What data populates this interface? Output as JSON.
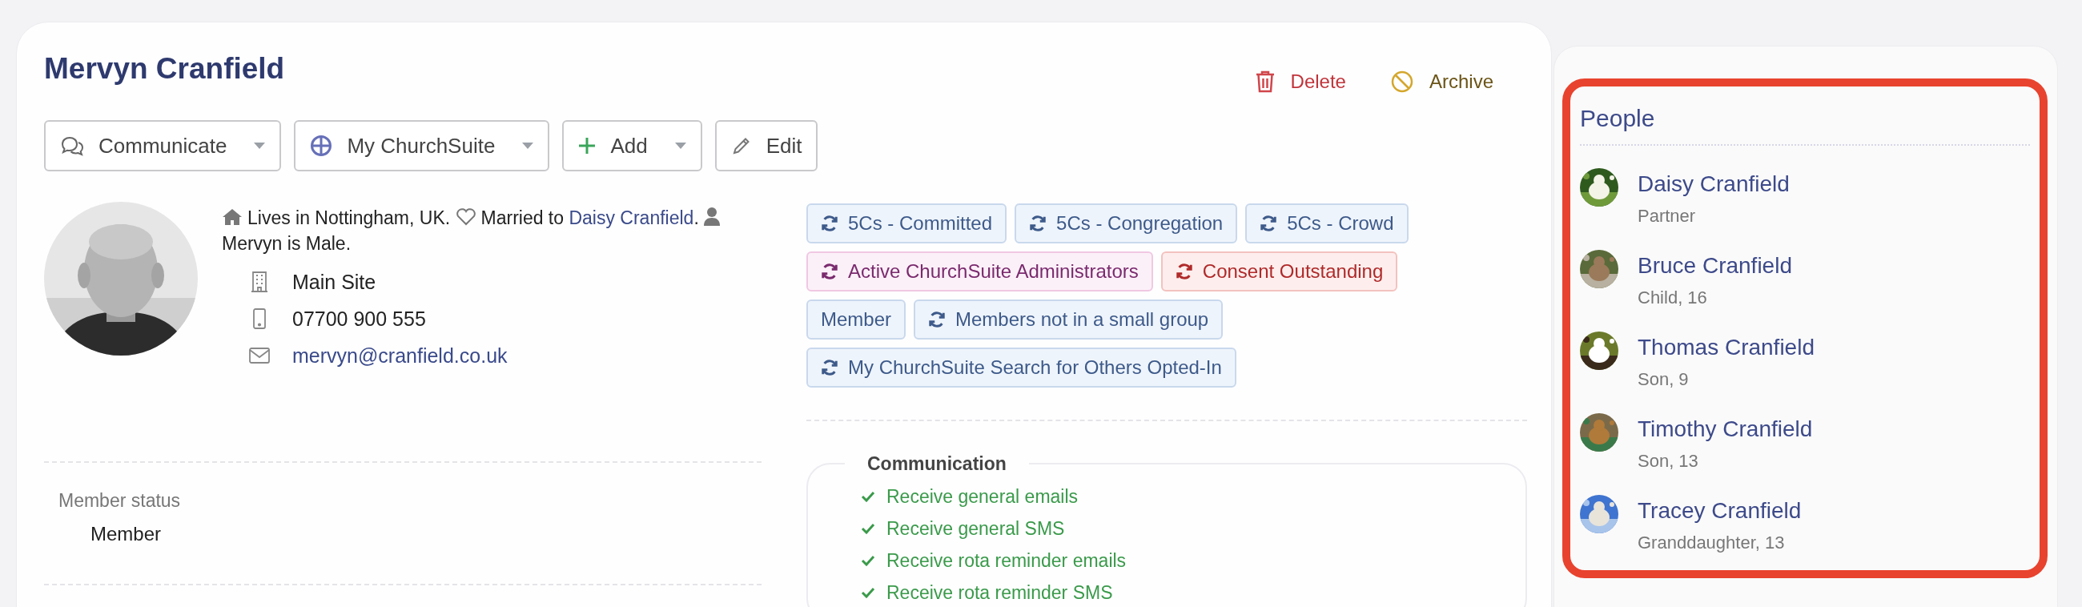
{
  "profile": {
    "name": "Mervyn Cranfield",
    "actions": [
      {
        "label": "Delete",
        "kind": "delete"
      },
      {
        "label": "Archive",
        "kind": "archive"
      }
    ],
    "buttons": [
      {
        "label": "Communicate",
        "kind": "chat",
        "dropdown": true
      },
      {
        "label": "My ChurchSuite",
        "kind": "globe",
        "dropdown": true
      },
      {
        "label": "Add",
        "kind": "plus",
        "dropdown": true
      },
      {
        "label": "Edit",
        "kind": "pencil",
        "dropdown": false
      }
    ],
    "summary": {
      "home": "Lives in Nottingham, UK.",
      "married_prefix": "Married to",
      "spouse": "Daisy Cranfield",
      "married_suffix": ".",
      "gender": "Mervyn is Male."
    },
    "contacts": [
      {
        "kind": "site",
        "text": "Main Site"
      },
      {
        "kind": "phone",
        "text": "07700 900 555"
      },
      {
        "kind": "email",
        "text": "mervyn@cranfield.co.uk"
      }
    ],
    "fields": [
      {
        "label": "Member status",
        "value": "Member"
      }
    ]
  },
  "tags": [
    {
      "label": "5Cs - Committed",
      "kind": "default",
      "synced": true
    },
    {
      "label": "5Cs - Congregation",
      "kind": "default",
      "synced": true
    },
    {
      "label": "5Cs - Crowd",
      "kind": "default",
      "synced": true
    },
    {
      "label": "Active ChurchSuite Administrators",
      "kind": "admin",
      "synced": true
    },
    {
      "label": "Consent Outstanding",
      "kind": "alert",
      "synced": true
    },
    {
      "label": "Member",
      "kind": "default",
      "synced": false
    },
    {
      "label": "Members not in a small group",
      "kind": "default",
      "synced": true
    },
    {
      "label": "My ChurchSuite Search for Others Opted-In",
      "kind": "default",
      "synced": true
    }
  ],
  "communication": {
    "title": "Communication",
    "items": [
      {
        "label": "Receive general emails",
        "checked": true
      },
      {
        "label": "Receive general SMS",
        "checked": true
      },
      {
        "label": "Receive rota reminder emails",
        "checked": true
      },
      {
        "label": "Receive rota reminder SMS",
        "checked": true
      }
    ]
  },
  "people": {
    "title": "People",
    "items": [
      {
        "name": "Daisy Cranfield",
        "relation": "Partner"
      },
      {
        "name": "Bruce Cranfield",
        "relation": "Child, 16"
      },
      {
        "name": "Thomas Cranfield",
        "relation": "Son, 9"
      },
      {
        "name": "Timothy Cranfield",
        "relation": "Son, 13"
      },
      {
        "name": "Tracey Cranfield",
        "relation": "Granddaughter, 13"
      }
    ]
  }
}
